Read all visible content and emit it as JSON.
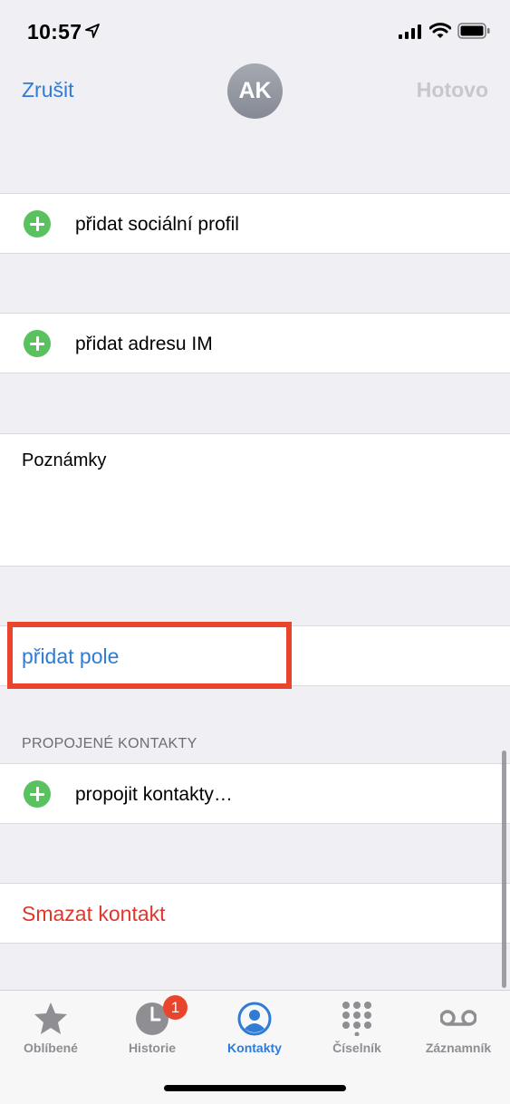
{
  "status_bar": {
    "time": "10:57"
  },
  "nav": {
    "cancel": "Zrušit",
    "avatar_initials": "AK",
    "done": "Hotovo"
  },
  "rows": {
    "social": "přidat sociální profil",
    "im": "přidat adresu IM",
    "notes": "Poznámky",
    "add_field": "přidat pole",
    "linked_header": "PROPOJENÉ KONTAKTY",
    "link": "propojit kontakty…",
    "delete": "Smazat kontakt"
  },
  "tabbar": {
    "items": [
      {
        "label": "Oblíbené",
        "icon": "star-icon"
      },
      {
        "label": "Historie",
        "icon": "clock-icon",
        "badge": "1"
      },
      {
        "label": "Kontakty",
        "icon": "person-circle-icon"
      },
      {
        "label": "Číselník",
        "icon": "keypad-icon"
      },
      {
        "label": "Záznamník",
        "icon": "voicemail-icon"
      }
    ],
    "active": "Kontakty"
  },
  "colors": {
    "accent": "#2f7bd6",
    "destructive": "#e0372d",
    "add": "#5ac15f",
    "highlight": "#e8452c"
  }
}
